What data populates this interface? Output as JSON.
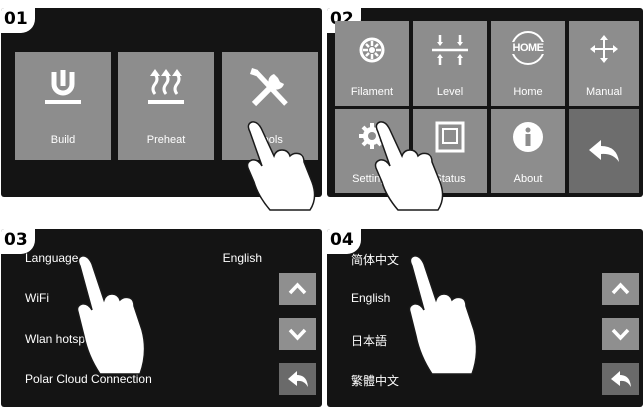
{
  "steps": [
    "01",
    "02",
    "03",
    "04"
  ],
  "panel1": {
    "tiles": [
      {
        "label": "Build",
        "icon": "build-icon"
      },
      {
        "label": "Preheat",
        "icon": "preheat-icon"
      },
      {
        "label": "Tools",
        "icon": "tools-icon"
      }
    ]
  },
  "panel2": {
    "tiles": [
      {
        "label": "Filament",
        "icon": "filament-icon"
      },
      {
        "label": "Level",
        "icon": "level-icon"
      },
      {
        "label": "Home",
        "icon": "home-icon",
        "icon_text": "HOME"
      },
      {
        "label": "Manual",
        "icon": "move-arrows-icon"
      },
      {
        "label": "Settings",
        "icon": "gear-icon"
      },
      {
        "label": "Status",
        "icon": "printer-status-icon"
      },
      {
        "label": "About",
        "icon": "info-icon"
      },
      {
        "label": "",
        "icon": "back-arrow-icon"
      }
    ]
  },
  "panel3": {
    "rows": [
      {
        "label": "Language",
        "value": "English"
      },
      {
        "label": "WiFi",
        "value": ""
      },
      {
        "label": "Wlan hotspot",
        "value": ""
      },
      {
        "label": "Polar Cloud Connection",
        "value": ""
      }
    ]
  },
  "panel4": {
    "rows": [
      {
        "label": "简体中文"
      },
      {
        "label": "English"
      },
      {
        "label": "日本語"
      },
      {
        "label": "繁體中文"
      }
    ]
  },
  "colors": {
    "screen": "#141414",
    "tile": "#8d8d8d",
    "tile_dark": "#6d6d6d"
  }
}
